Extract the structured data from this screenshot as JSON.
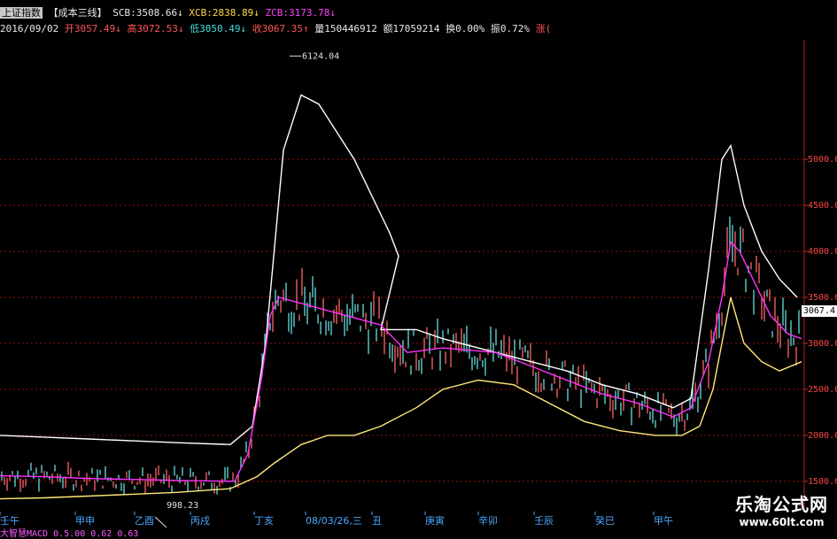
{
  "header": {
    "index_name": "上证指数",
    "indicator": "【成本三线】",
    "scb_label": "SCB:3508.66↓",
    "xcb_label": "XCB:2838.89↓",
    "zcb_label": "ZCB:3173.78↓",
    "date": "2016/09/02",
    "open": "开3057.49↓",
    "high": "高3072.53↓",
    "low": "低3050.49↓",
    "close": "收3067.35↑",
    "volume": "量150446912",
    "amount": "额17059214",
    "change_pct": "换0.00%",
    "amplitude": "振0.72%",
    "rise": "涨("
  },
  "price_tag": "3067.4",
  "watermark": {
    "title": "乐淘公式网",
    "url": "www.60lt.com"
  },
  "bottom_strip": "大智慧MACD 0.5.00 0.62 0.63",
  "chart_data": {
    "type": "line",
    "title": "",
    "yticks": [
      "5000.0",
      "4500.0",
      "4000.0",
      "3500.0",
      "3000.0",
      "2500.0",
      "2000.0",
      "1500.0"
    ],
    "ylim": [
      1200,
      6300
    ],
    "eras": [
      "壬午",
      "甲申",
      "乙酉",
      "丙戌",
      "丁亥",
      "08/03/26,三",
      "丑",
      "庚寅",
      "辛卯",
      "壬辰",
      "癸巳",
      "甲午"
    ],
    "annotations": {
      "high": "6124.04",
      "low": "998.23"
    },
    "series": [
      {
        "color": "#ffffff",
        "x": [
          0,
          50,
          100,
          150,
          200,
          260,
          285,
          300,
          320,
          340,
          360,
          380,
          400,
          420,
          440,
          450,
          430,
          470,
          500,
          520,
          560,
          600,
          640,
          680,
          720,
          760,
          780,
          800,
          815,
          825,
          840,
          860,
          880,
          900
        ],
        "y": [
          2000,
          1980,
          1960,
          1940,
          1920,
          1900,
          2100,
          3000,
          5100,
          5700,
          5600,
          5300,
          5000,
          4600,
          4200,
          3950,
          3150,
          3150,
          3050,
          3000,
          2900,
          2800,
          2700,
          2550,
          2450,
          2300,
          2400,
          3800,
          5000,
          5150,
          4500,
          4000,
          3700,
          3500
        ]
      },
      {
        "color": "#ff33ff",
        "x": [
          0,
          50,
          100,
          150,
          200,
          265,
          280,
          295,
          305,
          315,
          430,
          460,
          500,
          560,
          600,
          640,
          680,
          720,
          760,
          780,
          800,
          815,
          825,
          835,
          850,
          870,
          890,
          905
        ],
        "y": [
          1560,
          1550,
          1530,
          1520,
          1510,
          1500,
          1800,
          2600,
          3300,
          3500,
          3200,
          2900,
          2950,
          2900,
          2750,
          2600,
          2450,
          2350,
          2200,
          2300,
          2800,
          3500,
          4100,
          4000,
          3700,
          3300,
          3100,
          3050
        ]
      },
      {
        "color": "#ffe87a",
        "x": [
          0,
          50,
          100,
          150,
          200,
          260,
          290,
          310,
          340,
          370,
          400,
          430,
          470,
          500,
          540,
          580,
          620,
          660,
          700,
          740,
          770,
          790,
          805,
          815,
          825,
          840,
          860,
          880,
          905
        ],
        "y": [
          1310,
          1320,
          1340,
          1360,
          1380,
          1420,
          1550,
          1700,
          1900,
          2000,
          2000,
          2100,
          2300,
          2500,
          2600,
          2550,
          2350,
          2150,
          2050,
          2000,
          2000,
          2100,
          2500,
          3000,
          3500,
          3000,
          2800,
          2700,
          2800
        ]
      }
    ]
  }
}
